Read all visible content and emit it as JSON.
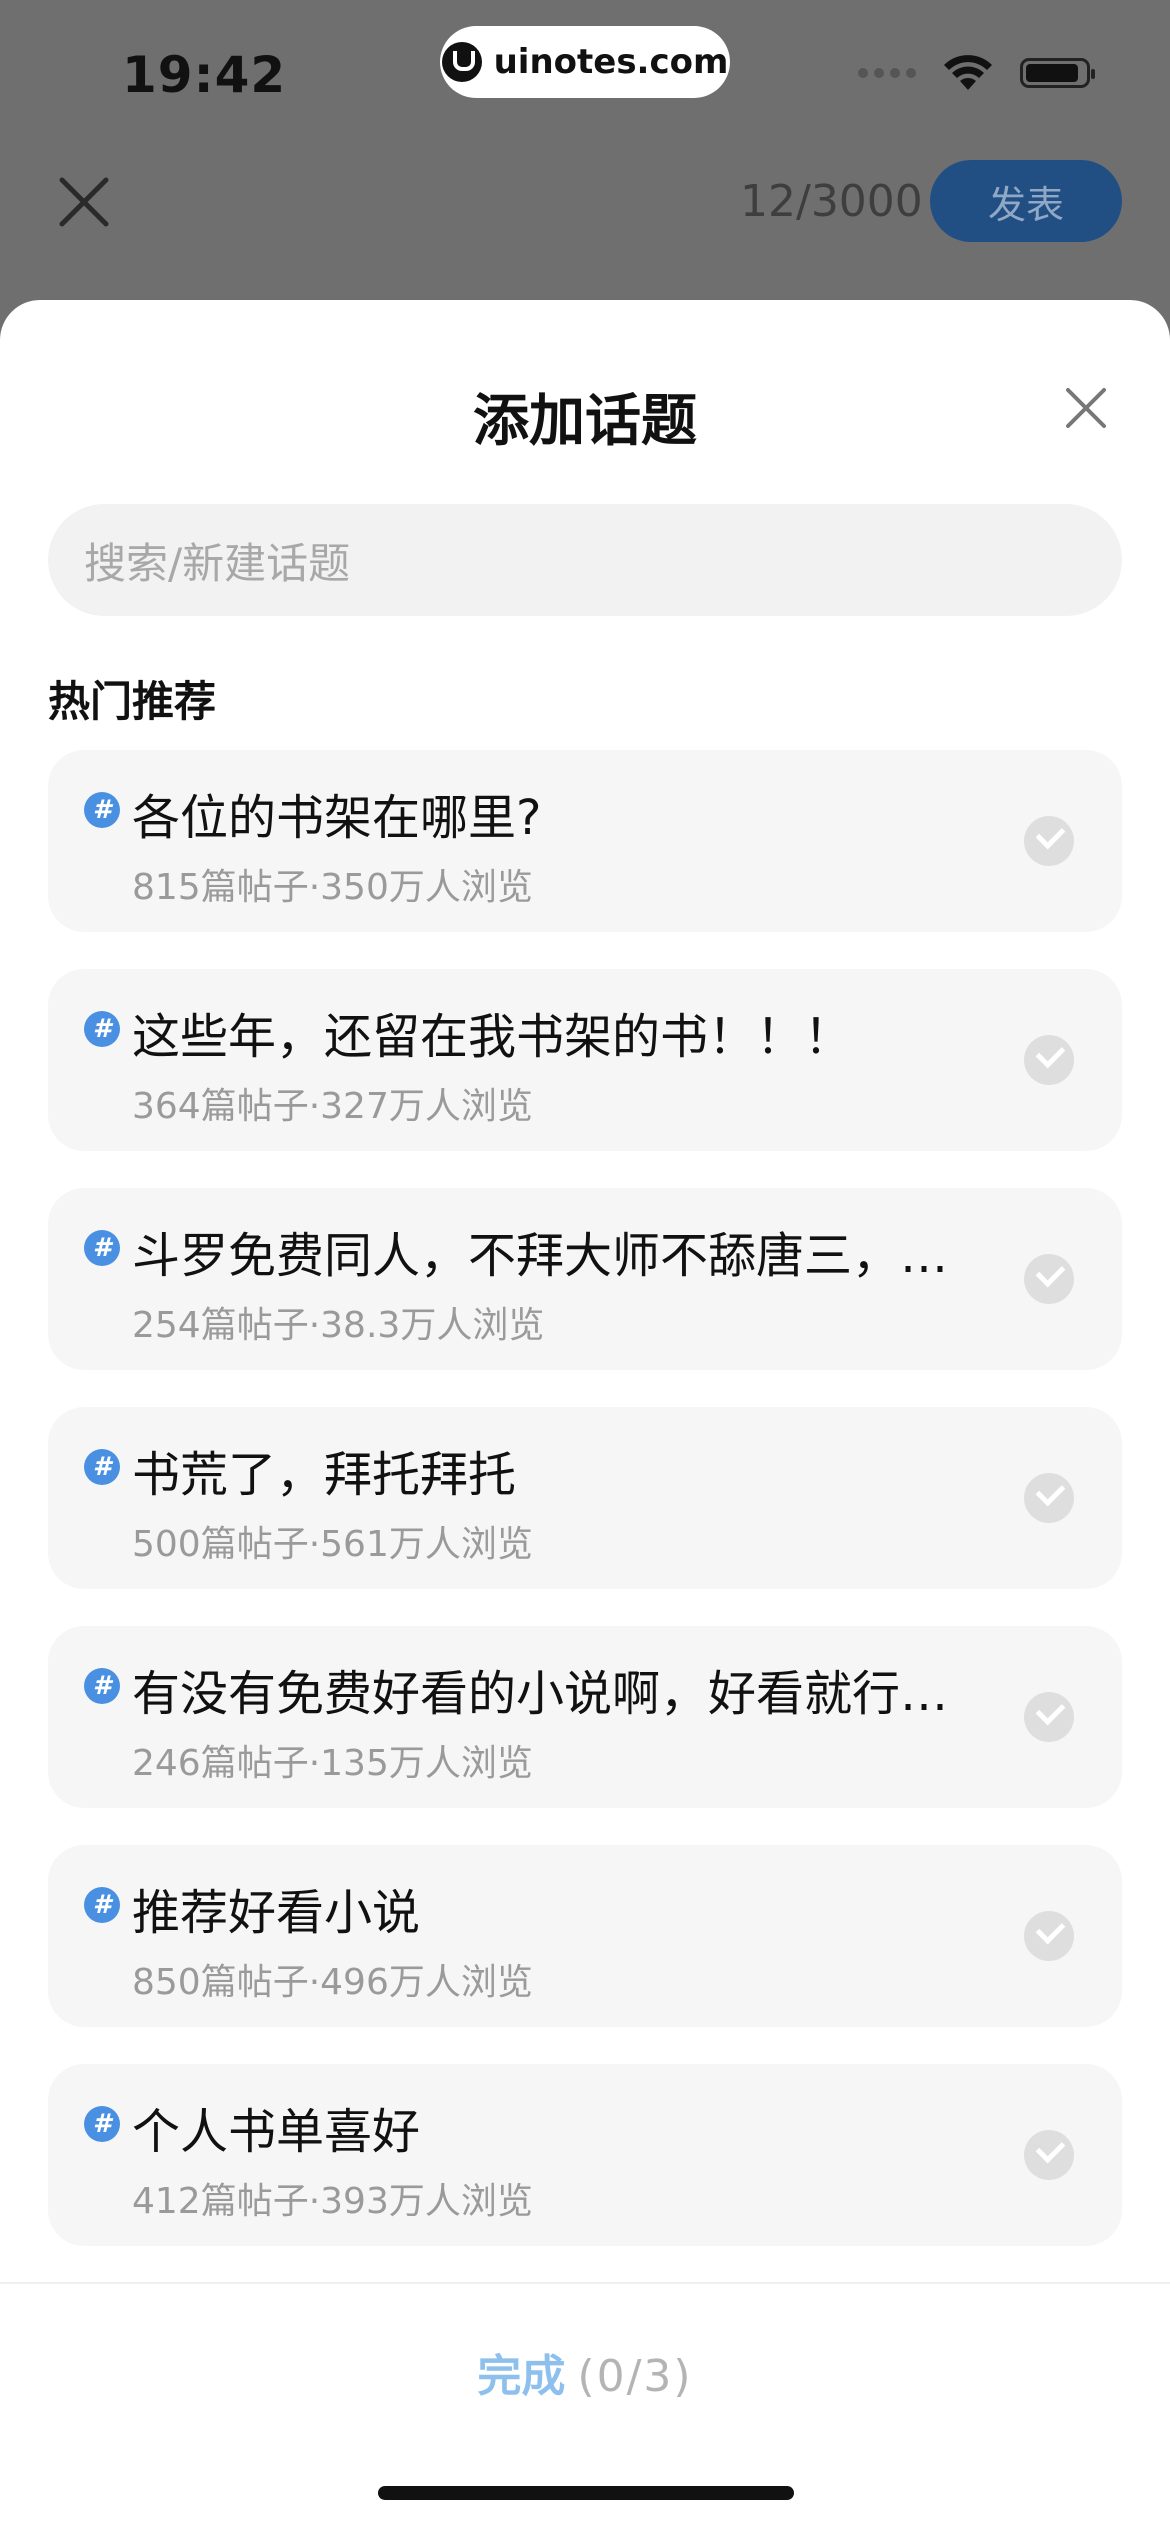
{
  "status_bar": {
    "time": "19:42",
    "watermark": "uinotes.com",
    "icons": [
      "cellular-dots-icon",
      "wifi-icon",
      "battery-icon"
    ]
  },
  "compose_header": {
    "close_icon": "close-icon",
    "char_counter": "12/3000",
    "publish_label": "发表"
  },
  "sheet": {
    "title": "添加话题",
    "close_icon": "close-icon",
    "search_placeholder": "搜索/新建话题",
    "section_title": "热门推荐",
    "topics": [
      {
        "title": "各位的书架在哪里?",
        "meta": "815篇帖子·350万人浏览"
      },
      {
        "title": "这些年，还留在我书架的书！！！",
        "meta": "364篇帖子·327万人浏览"
      },
      {
        "title": "斗罗免费同人，不拜大师不舔唐三，…",
        "meta": "254篇帖子·38.3万人浏览"
      },
      {
        "title": "书荒了，拜托拜托",
        "meta": "500篇帖子·561万人浏览"
      },
      {
        "title": "有没有免费好看的小说啊，好看就行…",
        "meta": "246篇帖子·135万人浏览"
      },
      {
        "title": "推荐好看小说",
        "meta": "850篇帖子·496万人浏览"
      },
      {
        "title": "个人书单喜好",
        "meta": "412篇帖子·393万人浏览"
      }
    ],
    "done_label": "完成",
    "done_count": "(0/3)"
  },
  "colors": {
    "overlay": "#6f6f6f",
    "accent_blue": "#4a90e2",
    "done_blue": "#8ec0ee",
    "publish_button": "#214f84"
  }
}
